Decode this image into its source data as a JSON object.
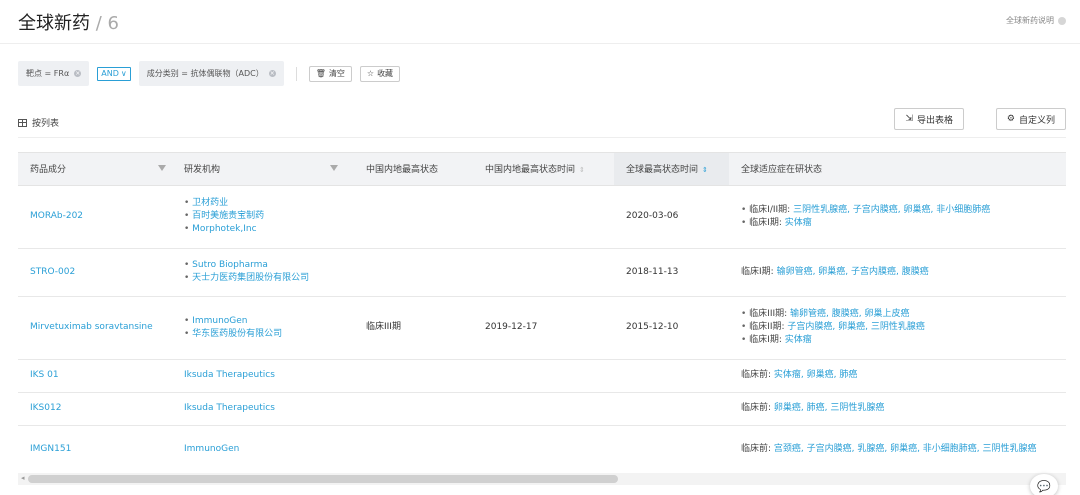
{
  "header": {
    "title": "全球新药",
    "separator": "/",
    "count": "6",
    "help_label": "全球新药说明"
  },
  "filters": {
    "target_chip": "靶点 = FRα",
    "logic": "AND",
    "class_chip": "成分类别 = 抗体偶联物（ADC）",
    "clear_label": "清空",
    "save_label": "收藏"
  },
  "toolbar": {
    "view_label": "按列表",
    "export_label": "导出表格",
    "custom_cols_label": "自定义列"
  },
  "table": {
    "columns": [
      "药品成分",
      "研发机构",
      "中国内地最高状态",
      "中国内地最高状态时间",
      "全球最高状态时间",
      "全球适应症在研状态"
    ],
    "rows": [
      {
        "drug": "MORAb-202",
        "orgs": [
          "卫材药业",
          "百时美施贵宝制药",
          "Morphotek,Inc"
        ],
        "cn_status": "",
        "cn_date": "",
        "global_date": "2020-03-06",
        "indications": [
          {
            "stage": "临床I/II期:",
            "items": "三阴性乳腺癌, 子宫内膜癌, 卵巢癌, 非小细胞肺癌"
          },
          {
            "stage": "临床I期:",
            "items": "实体瘤"
          }
        ]
      },
      {
        "drug": "STRO-002",
        "orgs": [
          "Sutro Biopharma",
          "天士力医药集团股份有限公司"
        ],
        "cn_status": "",
        "cn_date": "",
        "global_date": "2018-11-13",
        "indications": [
          {
            "stage": "临床I期:",
            "items": "输卵管癌, 卵巢癌, 子宫内膜癌, 腹膜癌"
          }
        ]
      },
      {
        "drug": "Mirvetuximab soravtansine",
        "orgs": [
          "ImmunoGen",
          "华东医药股份有限公司"
        ],
        "cn_status": "临床III期",
        "cn_date": "2019-12-17",
        "global_date": "2015-12-10",
        "indications": [
          {
            "stage": "临床III期:",
            "items": "输卵管癌, 腹膜癌, 卵巢上皮癌"
          },
          {
            "stage": "临床II期:",
            "items": "子宫内膜癌, 卵巢癌, 三阴性乳腺癌"
          },
          {
            "stage": "临床I期:",
            "items": "实体瘤"
          }
        ]
      },
      {
        "drug": "IKS 01",
        "orgs": [
          "Iksuda Therapeutics"
        ],
        "cn_status": "",
        "cn_date": "",
        "global_date": "",
        "indications": [
          {
            "stage": "临床前:",
            "items": "实体瘤, 卵巢癌, 肺癌"
          }
        ]
      },
      {
        "drug": "IKS012",
        "orgs": [
          "Iksuda Therapeutics"
        ],
        "cn_status": "",
        "cn_date": "",
        "global_date": "",
        "indications": [
          {
            "stage": "临床前:",
            "items": "卵巢癌, 肺癌, 三阴性乳腺癌"
          }
        ]
      },
      {
        "drug": "IMGN151",
        "orgs": [
          "ImmunoGen"
        ],
        "cn_status": "",
        "cn_date": "",
        "global_date": "",
        "indications": [
          {
            "stage": "临床前:",
            "items": "宫颈癌, 子宫内膜癌, 乳腺癌, 卵巢癌, 非小细胞肺癌, 三阴性乳腺癌"
          }
        ]
      }
    ]
  },
  "colors": {
    "link": "#2a9fd6",
    "header_bg": "#f2f3f5"
  }
}
